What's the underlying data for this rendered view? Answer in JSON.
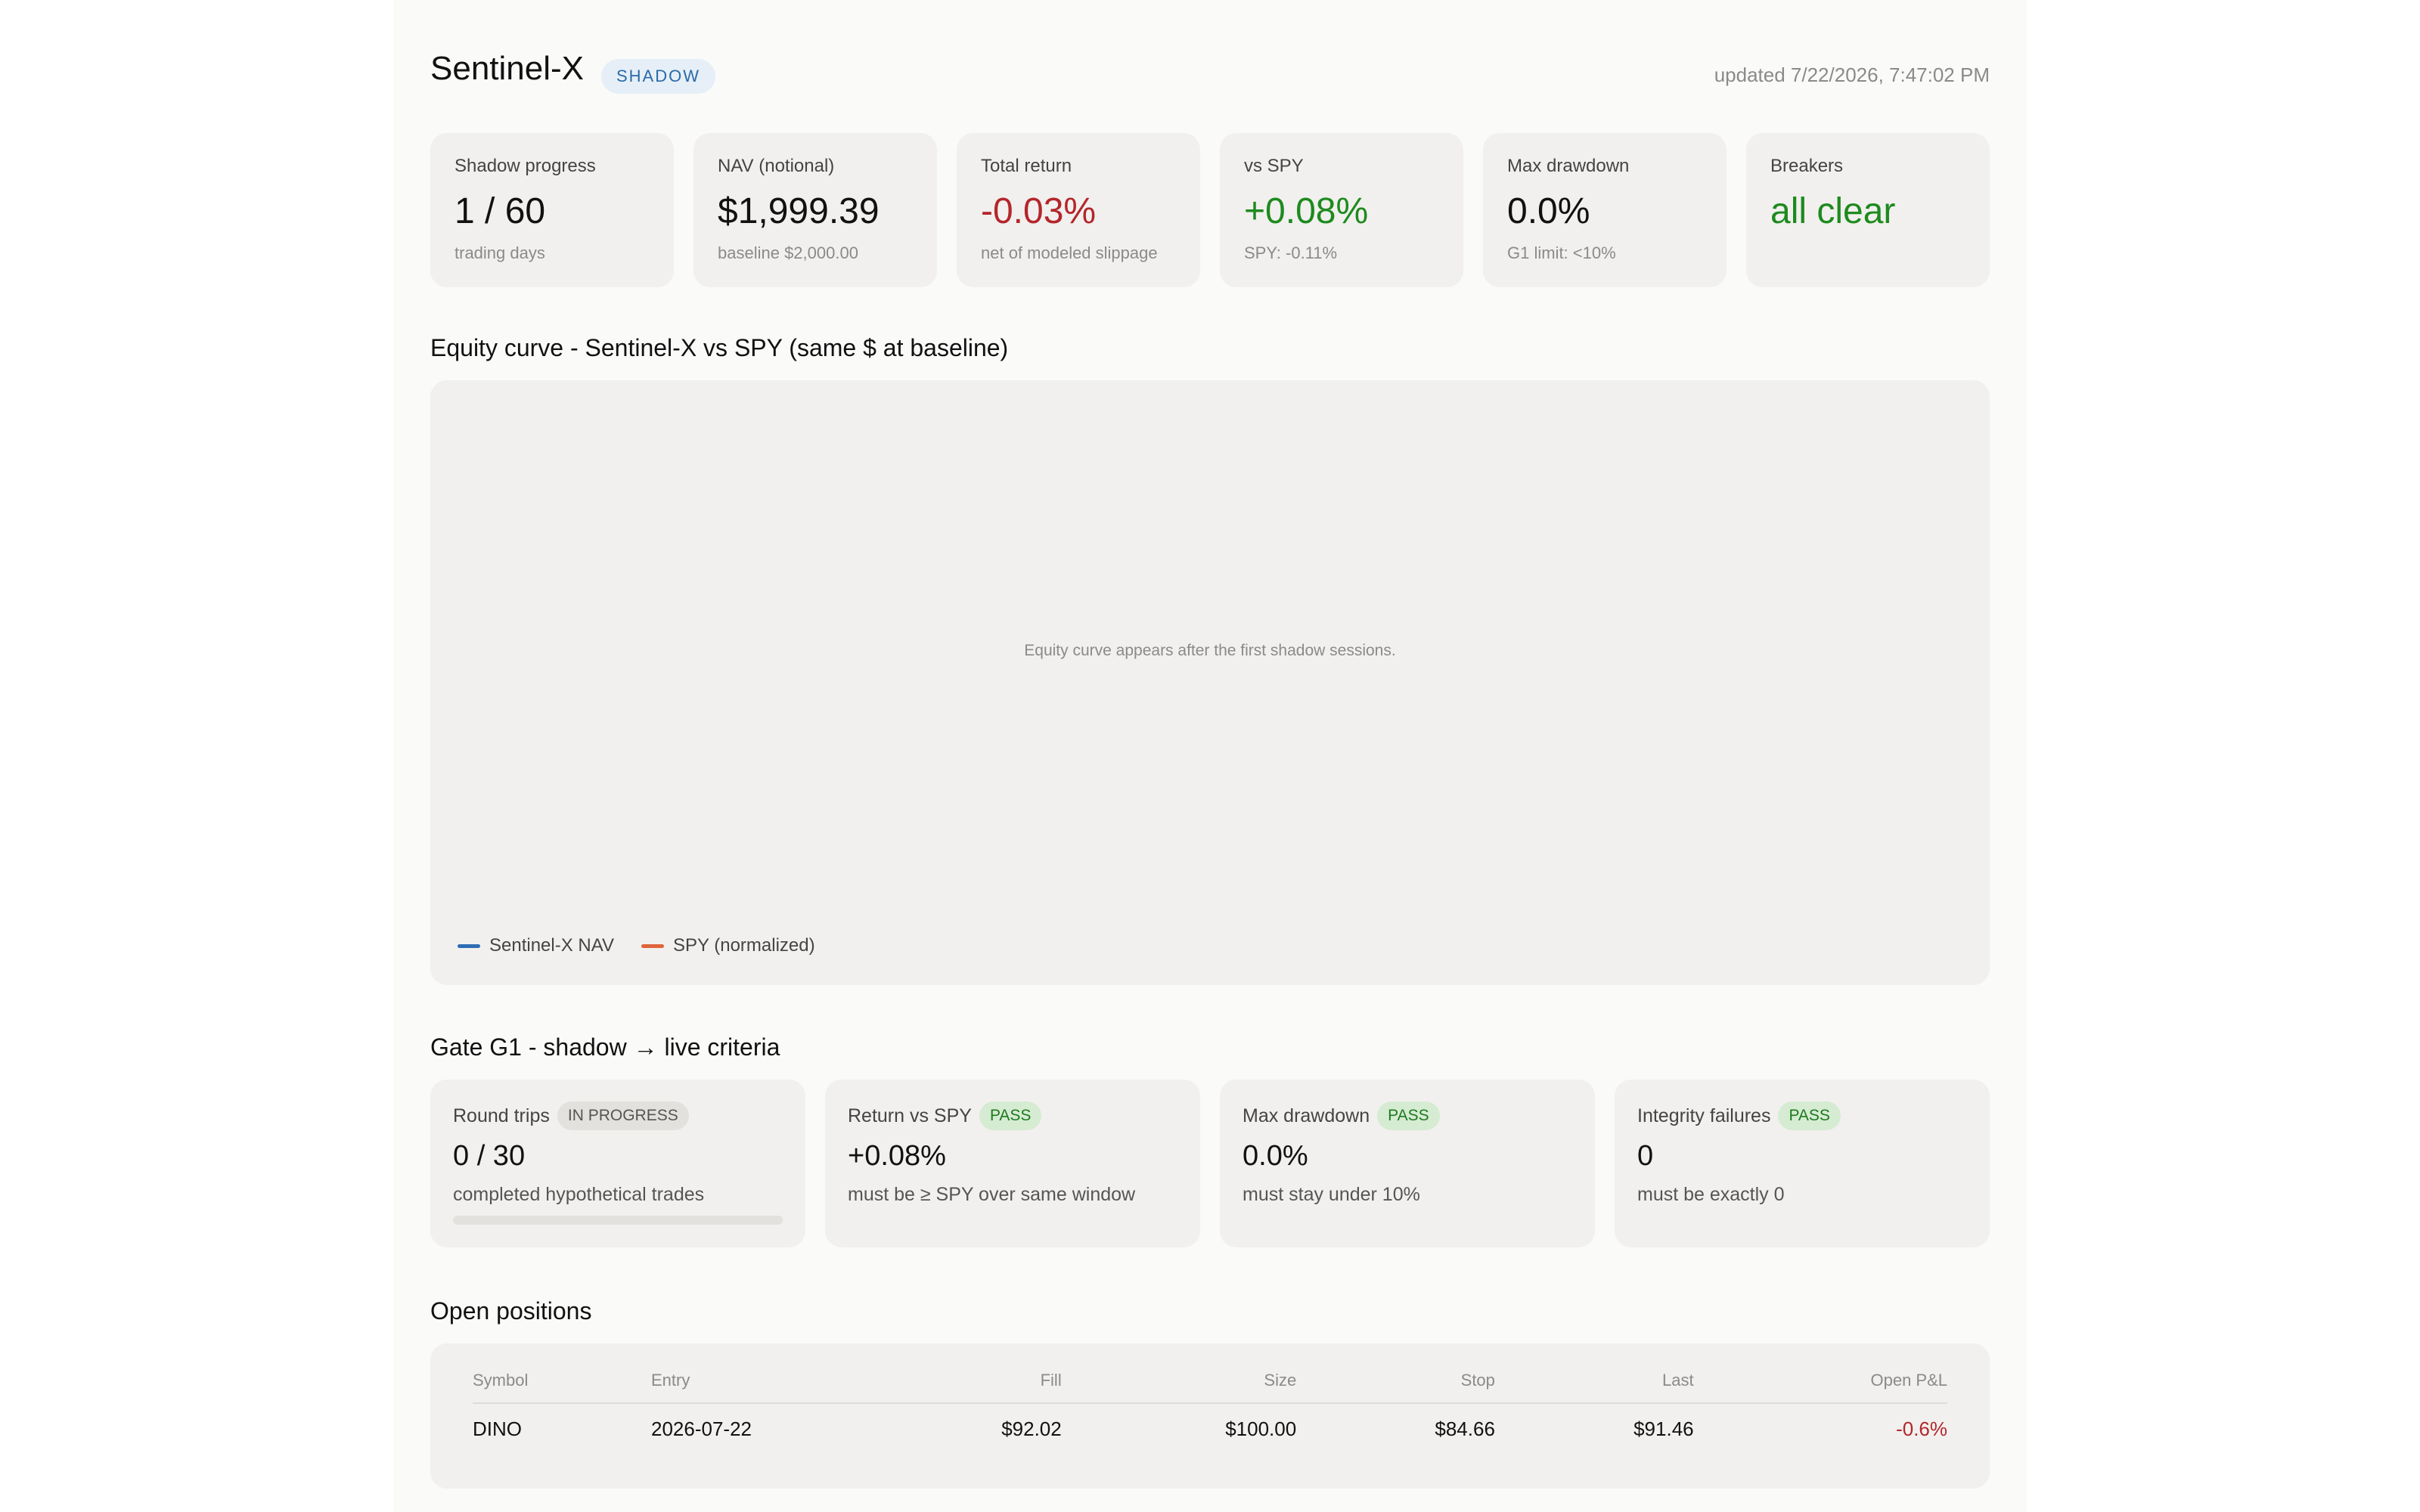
{
  "header": {
    "title": "Sentinel-X",
    "mode_badge": "SHADOW",
    "updated": "updated 7/22/2026, 7:47:02 PM"
  },
  "kpis": [
    {
      "label": "Shadow progress",
      "value": "1 / 60",
      "sub": "trading days",
      "tone": "neutral"
    },
    {
      "label": "NAV (notional)",
      "value": "$1,999.39",
      "sub": "baseline $2,000.00",
      "tone": "neutral"
    },
    {
      "label": "Total return",
      "value": "-0.03%",
      "sub": "net of modeled slippage",
      "tone": "negative"
    },
    {
      "label": "vs SPY",
      "value": "+0.08%",
      "sub": "SPY: -0.11%",
      "tone": "positive"
    },
    {
      "label": "Max drawdown",
      "value": "0.0%",
      "sub": "G1 limit: <10%",
      "tone": "neutral"
    },
    {
      "label": "Breakers",
      "value": "all clear",
      "sub": "",
      "tone": "positive"
    }
  ],
  "equity": {
    "title": "Equity curve - Sentinel-X vs SPY (same $ at baseline)",
    "empty_message": "Equity curve appears after the first shadow sessions.",
    "legend": [
      {
        "name": "Sentinel-X NAV",
        "color": "#2f6db5"
      },
      {
        "name": "SPY (normalized)",
        "color": "#e0643a"
      }
    ]
  },
  "gate": {
    "title": "Gate G1 - shadow → live criteria",
    "criteria": [
      {
        "label": "Round trips",
        "status": "IN PROGRESS",
        "value": "0 / 30",
        "sub": "completed hypothetical trades",
        "progress": 0
      },
      {
        "label": "Return vs SPY",
        "status": "PASS",
        "value": "+0.08%",
        "sub": "must be ≥ SPY over same window"
      },
      {
        "label": "Max drawdown",
        "status": "PASS",
        "value": "0.0%",
        "sub": "must stay under 10%"
      },
      {
        "label": "Integrity failures",
        "status": "PASS",
        "value": "0",
        "sub": "must be exactly 0"
      }
    ]
  },
  "positions": {
    "title": "Open positions",
    "columns": [
      "Symbol",
      "Entry",
      "Fill",
      "Size",
      "Stop",
      "Last",
      "Open P&L"
    ],
    "rows": [
      {
        "symbol": "DINO",
        "entry": "2026-07-22",
        "fill": "$92.02",
        "size": "$100.00",
        "stop": "$84.66",
        "last": "$91.46",
        "pnl": "-0.6%"
      }
    ]
  },
  "colors": {
    "negative": "#b3262b",
    "positive": "#1d8a1d",
    "accent": "#2a6aa8"
  }
}
